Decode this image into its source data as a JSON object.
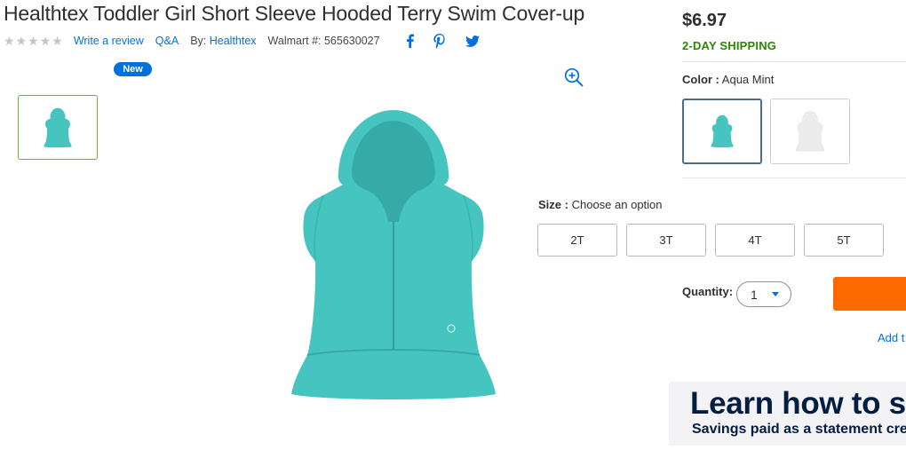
{
  "product": {
    "title": "Healthtex Toddler Girl Short Sleeve Hooded Terry Swim Cover-up",
    "review_link": "Write a review",
    "qa_link": "Q&A",
    "brand_prefix": "By:",
    "brand": "Healthtex",
    "walmart_number": "Walmart #: 565630027",
    "rating": 0,
    "new_badge": "New"
  },
  "icons": {
    "social": [
      "facebook-icon",
      "pinterest-icon",
      "twitter-icon"
    ],
    "zoom": "zoom-in-icon"
  },
  "pricing": {
    "price": "$6.97",
    "shipping": "2-DAY SHIPPING"
  },
  "color": {
    "label": "Color :",
    "selected": "Aqua Mint",
    "options": [
      {
        "swatch": "#46c4c0"
      },
      {
        "swatch": "#ececec"
      }
    ]
  },
  "size": {
    "label": "Size :",
    "placeholder": "Choose an option",
    "options": [
      "2T",
      "3T",
      "4T",
      "5T"
    ]
  },
  "quantity": {
    "label": "Quantity:",
    "value": "1"
  },
  "actions": {
    "add_link": "Add t"
  },
  "banner": {
    "headline": "Learn how to s",
    "subtext": "Savings paid as a statement cre"
  },
  "colors": {
    "accent_blue": "#0071dc",
    "shipping_green": "#2a8703",
    "cart_orange": "#ff6a00",
    "product_aqua": "#46c4c0",
    "thumb_border": "#6fb33f"
  }
}
